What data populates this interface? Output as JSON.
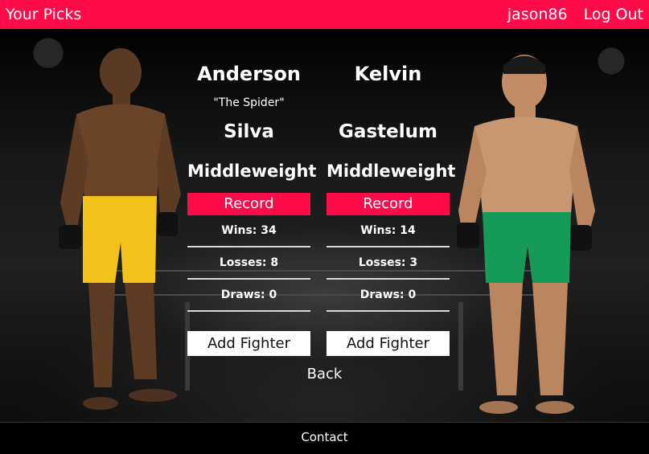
{
  "nav": {
    "brand": "Your Picks",
    "username": "jason86",
    "logout": "Log Out"
  },
  "fighters": [
    {
      "first_name": "Anderson",
      "nickname": "\"The Spider\"",
      "last_name": "Silva",
      "weight_class": "Middleweight",
      "record_label": "Record",
      "wins": "Wins: 34",
      "losses": "Losses: 8",
      "draws": "Draws: 0",
      "add_label": "Add Fighter",
      "shorts_color": "#f2c21a"
    },
    {
      "first_name": "Kelvin",
      "nickname": "",
      "last_name": "Gastelum",
      "weight_class": "Middleweight",
      "record_label": "Record",
      "wins": "Wins: 14",
      "losses": "Losses: 3",
      "draws": "Draws: 0",
      "add_label": "Add Fighter",
      "shorts_color": "#169a5a"
    }
  ],
  "back_label": "Back",
  "footer": {
    "contact": "Contact"
  },
  "colors": {
    "accent": "#ff0b4a",
    "background": "#0a0a0a"
  }
}
